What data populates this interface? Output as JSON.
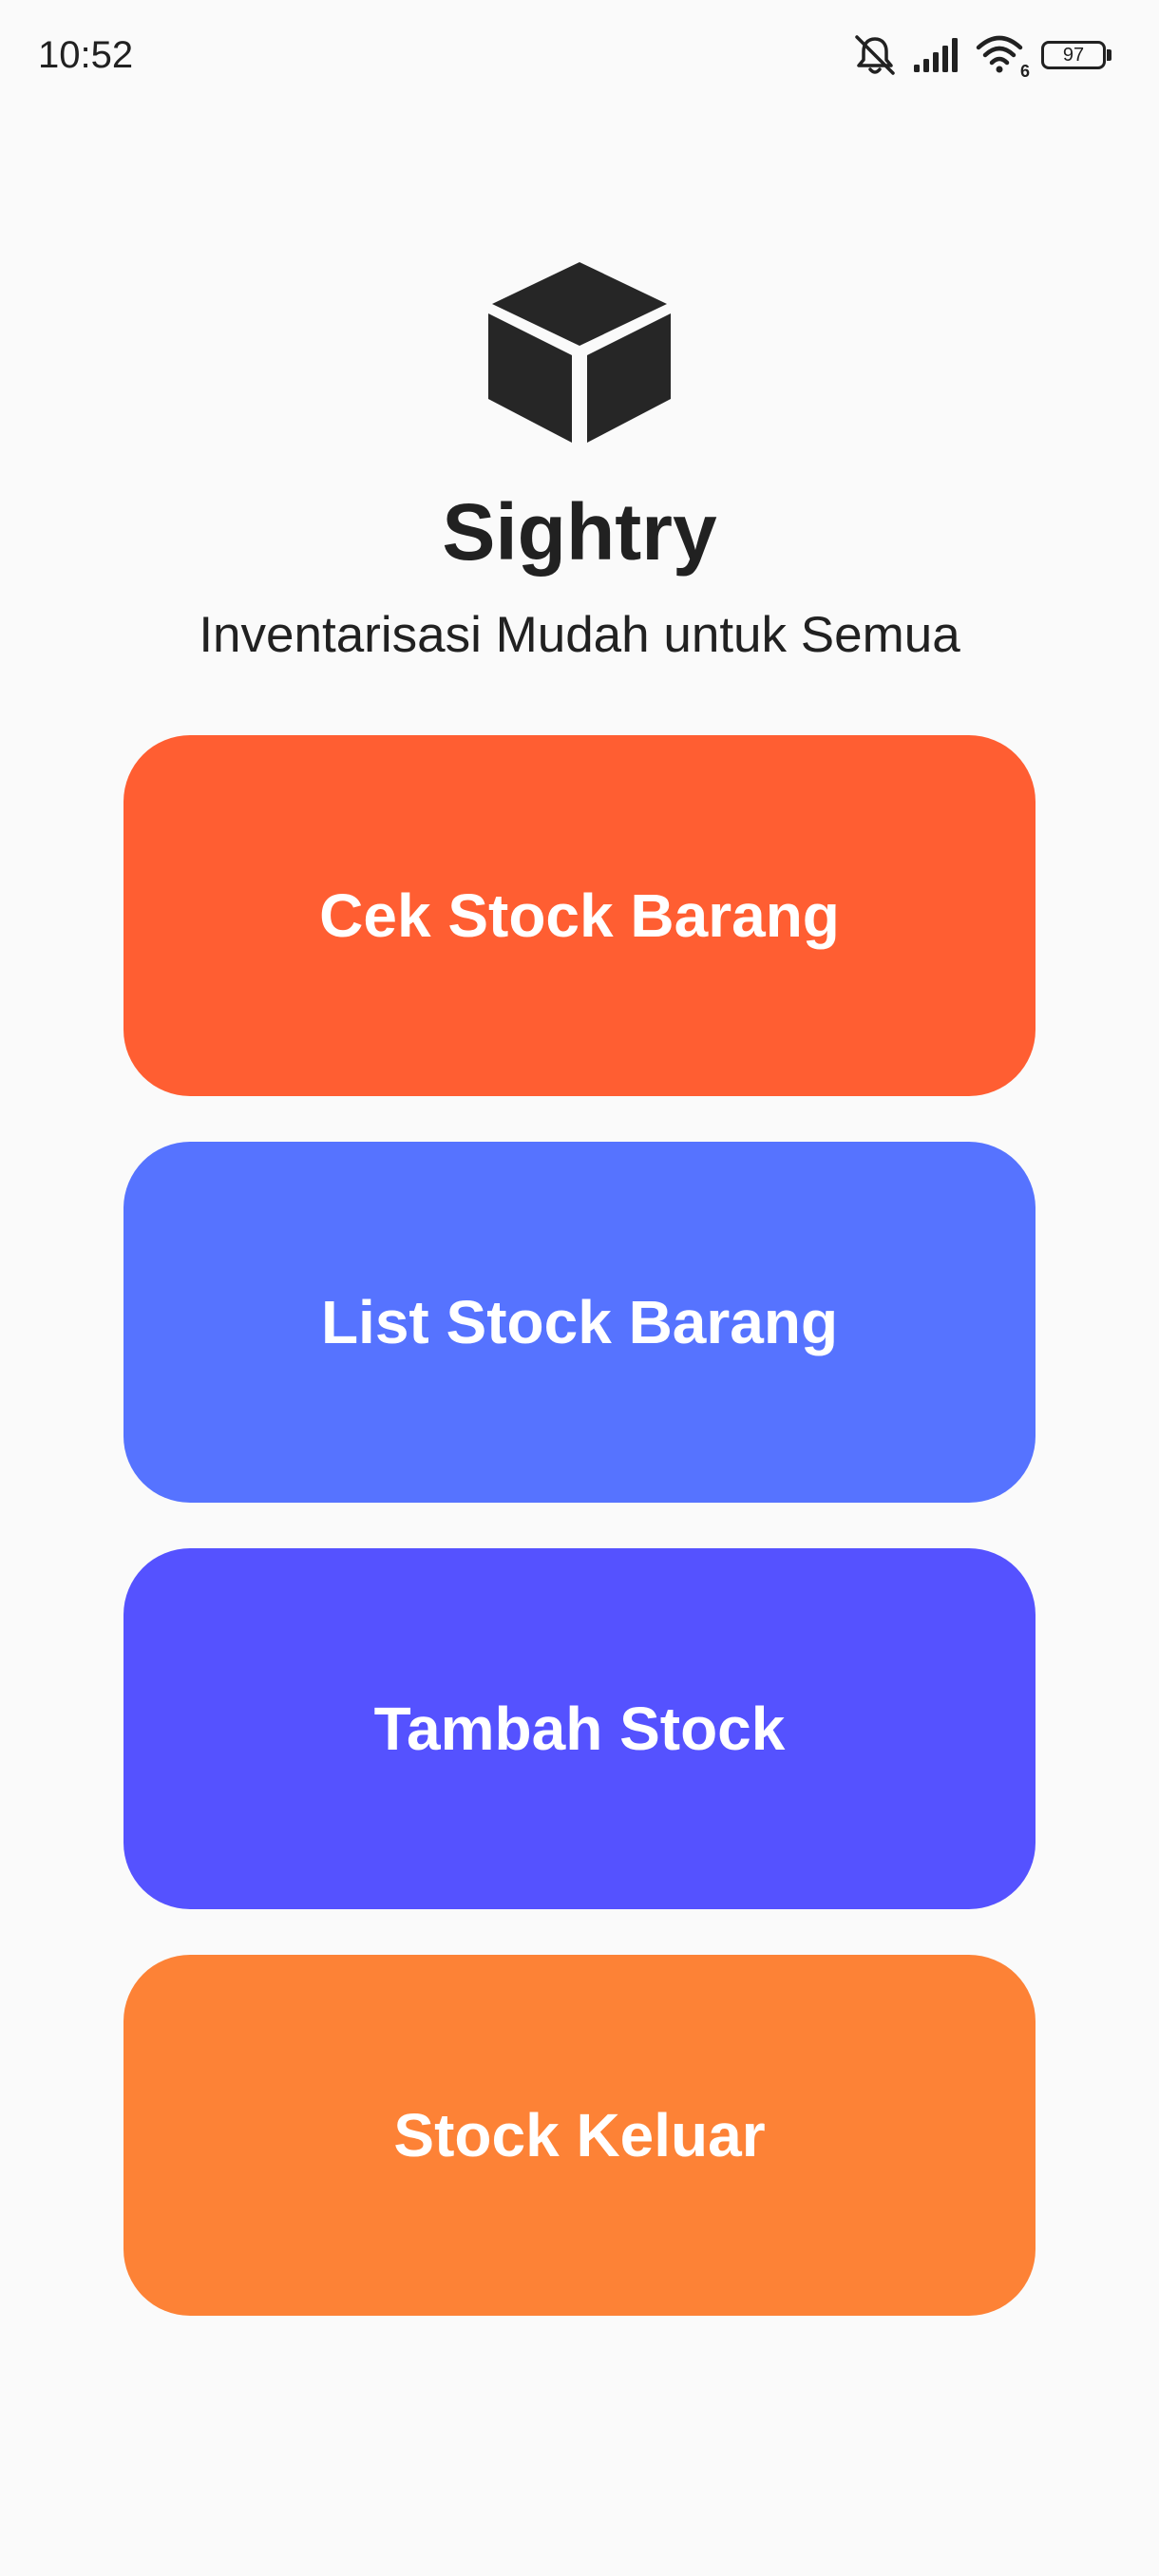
{
  "status_bar": {
    "time": "10:52",
    "battery": "97",
    "wifi_badge": "6",
    "icons": [
      "mute-icon",
      "signal-icon",
      "wifi-icon",
      "battery-icon"
    ]
  },
  "header": {
    "logo_icon": "cube-icon",
    "title": "Sightry",
    "subtitle": "Inventarisasi Mudah untuk Semua"
  },
  "menu": {
    "buttons": [
      {
        "label": "Cek Stock Barang",
        "color": "#FF5E32"
      },
      {
        "label": "List Stock Barang",
        "color": "#5673FF"
      },
      {
        "label": "Tambah Stock",
        "color": "#5552FF"
      },
      {
        "label": "Stock Keluar",
        "color": "#FD8236"
      }
    ]
  },
  "colors": {
    "background": "#FAFAFA",
    "text": "#212121",
    "button_text": "#FFFFFF"
  }
}
